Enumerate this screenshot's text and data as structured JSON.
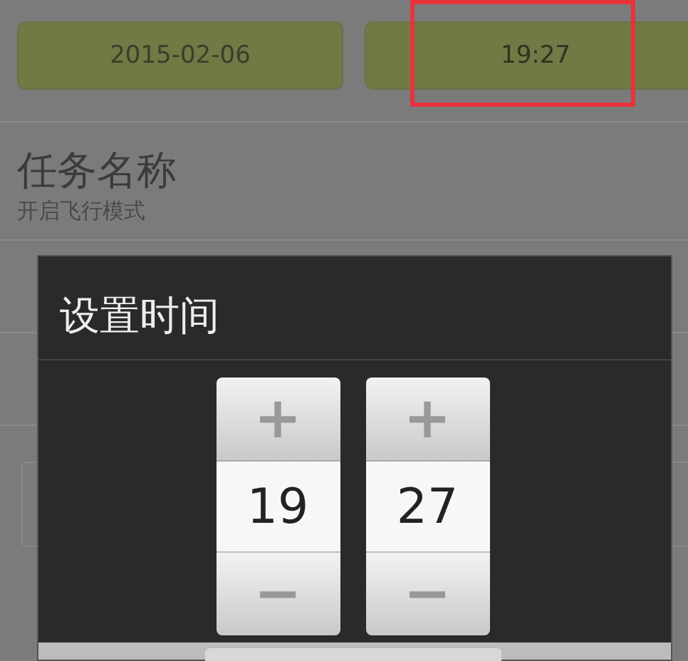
{
  "date_time_buttons": [
    {
      "label": "2015-02-06",
      "highlighted": false
    },
    {
      "label": "19:27",
      "highlighted": true
    }
  ],
  "task": {
    "title": "任务名称",
    "subtitle": "开启飞行模式"
  },
  "dialog": {
    "title": "设置时间",
    "spinners": [
      {
        "increment": "+",
        "value": "19",
        "decrement": "−"
      },
      {
        "increment": "+",
        "value": "27",
        "decrement": "−"
      }
    ]
  }
}
